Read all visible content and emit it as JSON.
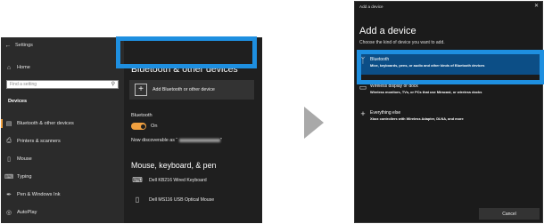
{
  "settings_window": {
    "title": "Settings",
    "home_label": "Home",
    "search_placeholder": "Find a setting",
    "section_label": "Devices",
    "nav_items": [
      {
        "label": "Bluetooth & other devices",
        "icon": "bluetooth-devices-icon",
        "active": true
      },
      {
        "label": "Printers & scanners",
        "icon": "printer-icon",
        "active": false
      },
      {
        "label": "Mouse",
        "icon": "mouse-icon",
        "active": false
      },
      {
        "label": "Typing",
        "icon": "keyboard-icon",
        "active": false
      },
      {
        "label": "Pen & Windows Ink",
        "icon": "pen-icon",
        "active": false
      },
      {
        "label": "AutoPlay",
        "icon": "autoplay-icon",
        "active": false
      }
    ],
    "content": {
      "title": "Bluetooth & other devices",
      "add_button_label": "Add Bluetooth or other device",
      "bluetooth_label": "Bluetooth",
      "toggle_state": "On",
      "discoverable_prefix": "Now discoverable as “",
      "discoverable_suffix": "”",
      "section_heading": "Mouse, keyboard, & pen",
      "devices": [
        {
          "name": "Dell KB216 Wired Keyboard",
          "icon": "keyboard-icon"
        },
        {
          "name": "Dell MS116 USB Optical Mouse",
          "icon": "mouse-icon"
        }
      ]
    }
  },
  "dialog": {
    "caption": "Add a device",
    "title": "Add a device",
    "subtitle": "Choose the kind of device you want to add.",
    "options": [
      {
        "title": "Bluetooth",
        "desc": "Mice, keyboards, pens, or audio and other kinds of Bluetooth devices",
        "icon": "bluetooth-icon",
        "selected": true
      },
      {
        "title": "Wireless display or dock",
        "desc": "Wireless monitors, TVs, or PCs that use Miracast, or wireless docks",
        "icon": "monitor-icon",
        "selected": false
      },
      {
        "title": "Everything else",
        "desc": "Xbox controllers with Wireless Adapter, DLNA, and more",
        "icon": "plus-icon",
        "selected": false
      }
    ],
    "cancel_label": "Cancel"
  },
  "colors": {
    "accent_toggle": "#f0a040",
    "highlight_box": "#1e8fe0",
    "selected_option": "#0c4e86"
  }
}
